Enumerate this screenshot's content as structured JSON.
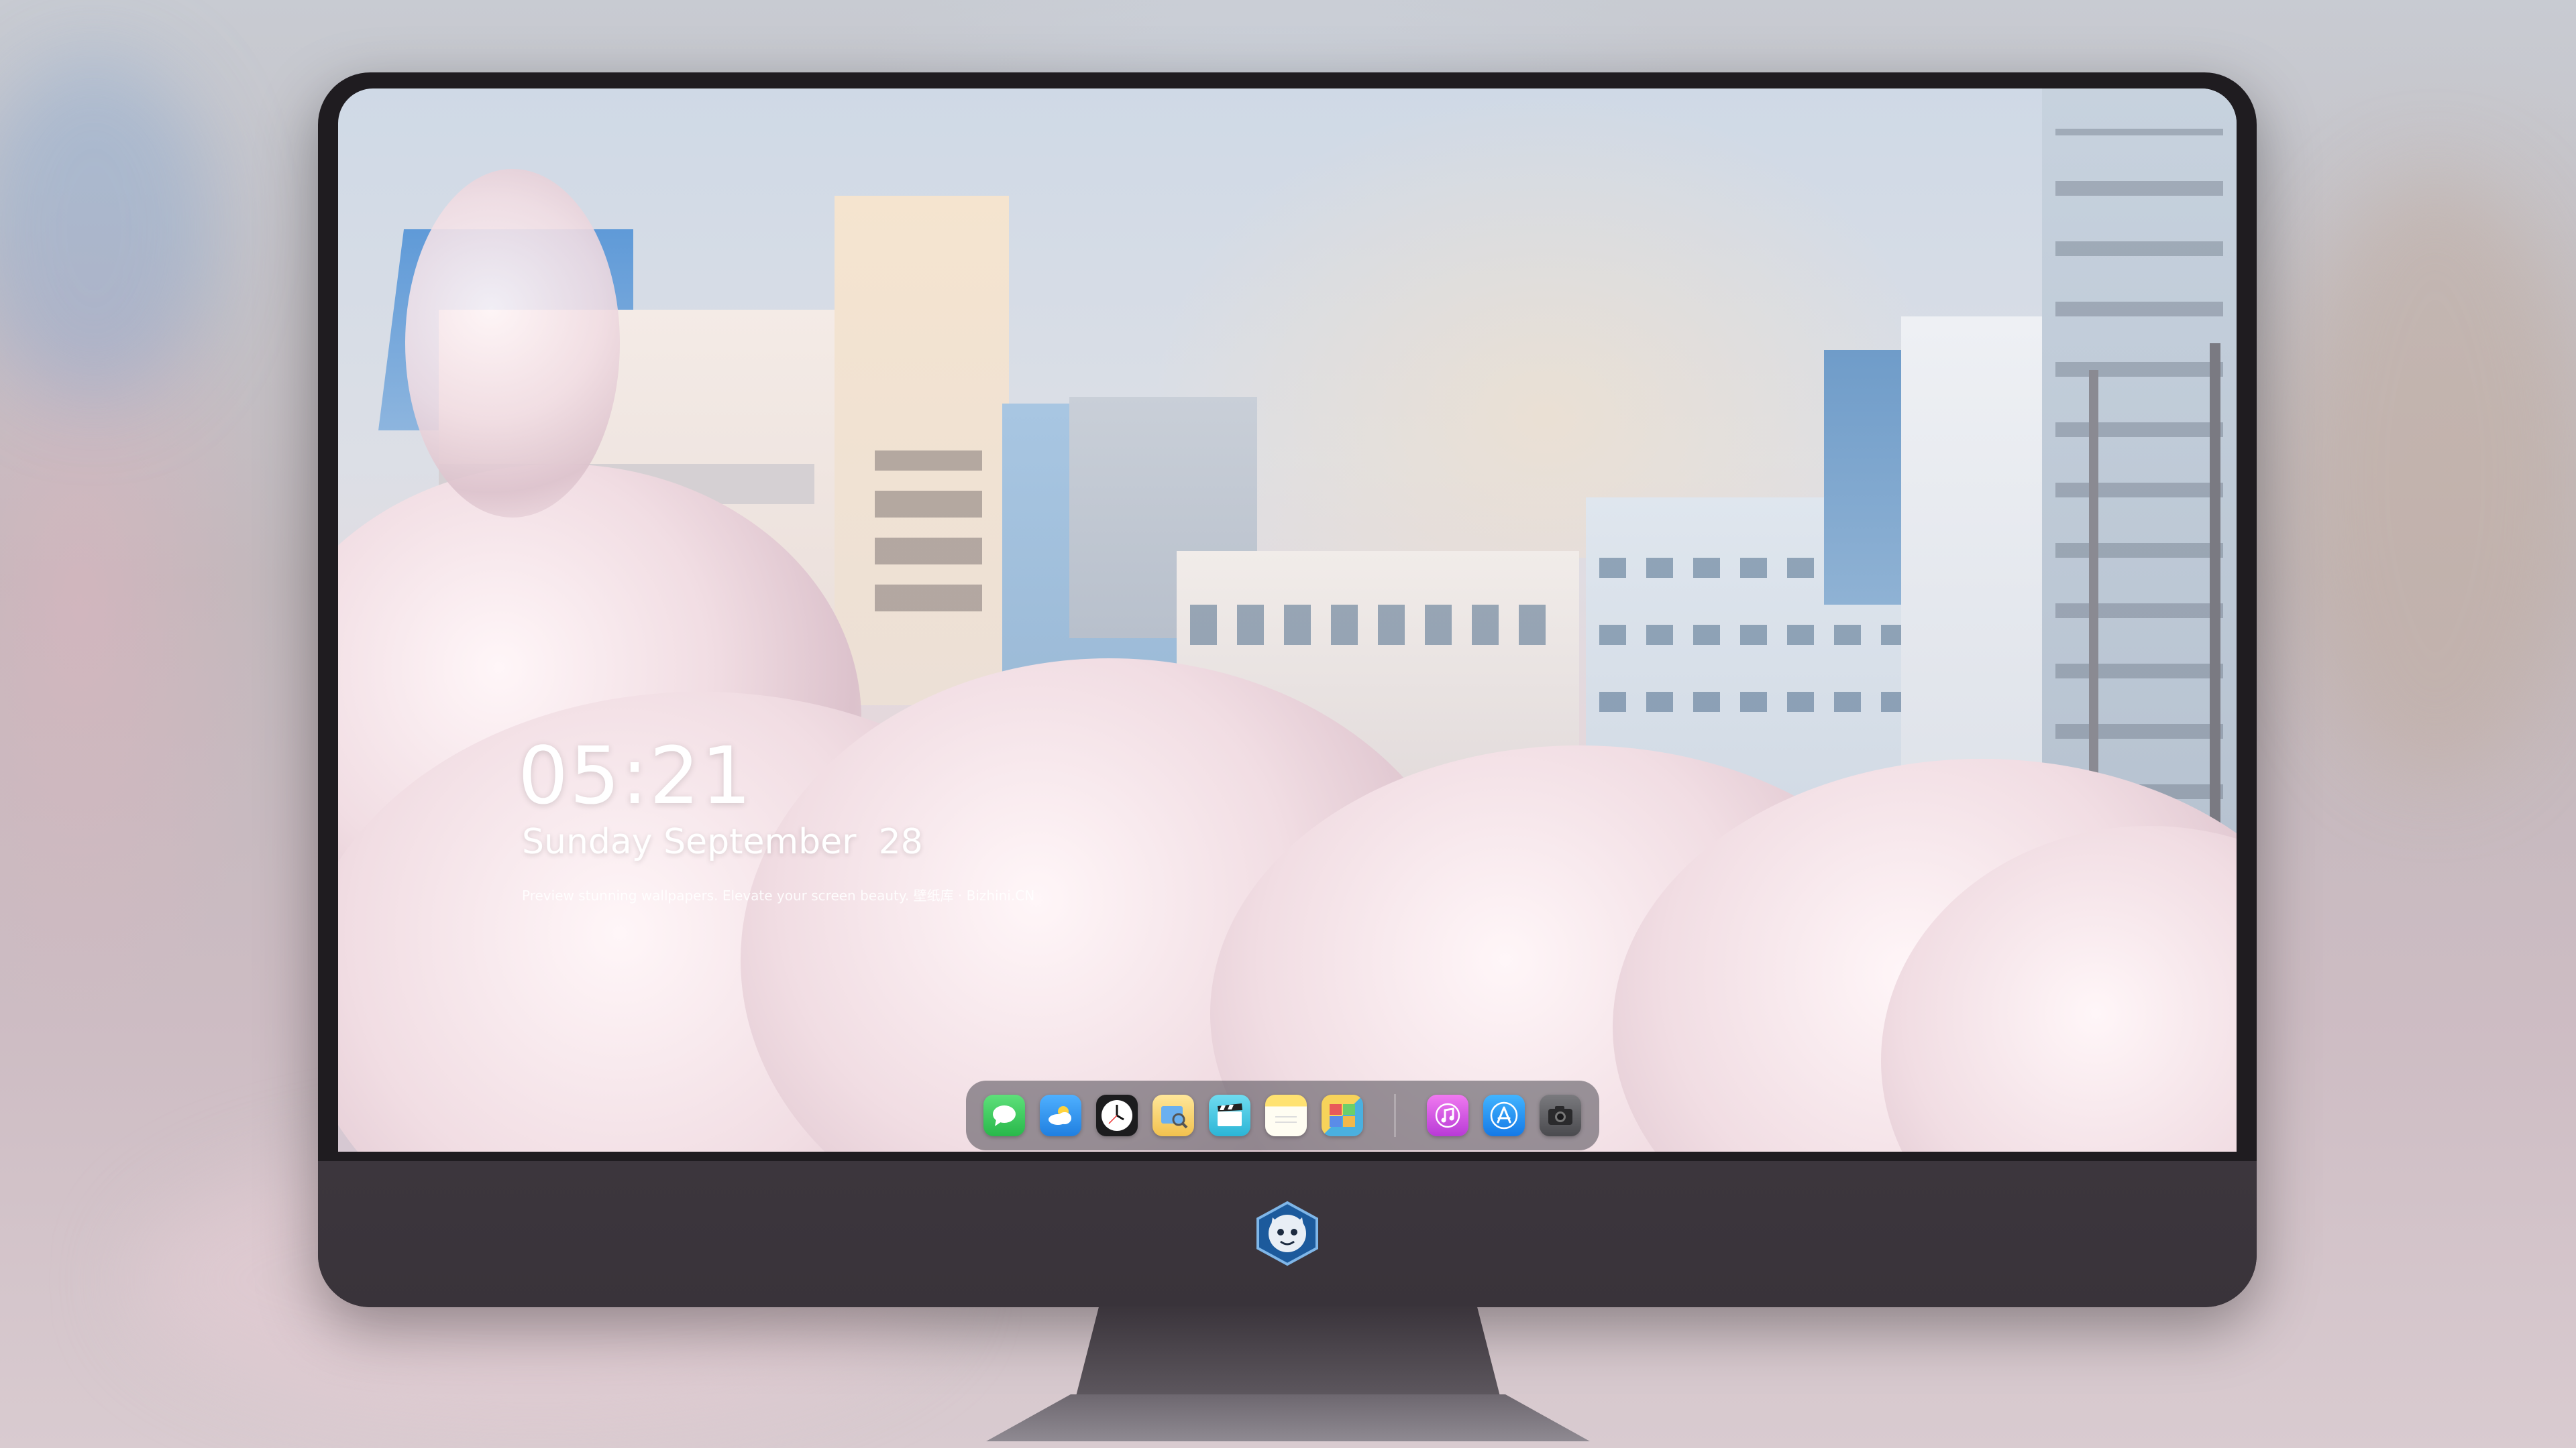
{
  "lockscreen": {
    "time": "05:21",
    "date": "Sunday September  28",
    "tagline": "Preview stunning wallpapers. Elevate your screen beauty. 壁纸库 · Bizhini.CN"
  },
  "dock": {
    "apps": [
      {
        "name": "Messages",
        "icon": "messages-icon",
        "color": "#34c759"
      },
      {
        "name": "Weather",
        "icon": "weather-icon",
        "color": "#2b8ff0"
      },
      {
        "name": "Clock",
        "icon": "clock-icon",
        "color": "#1c1c1e"
      },
      {
        "name": "Preview",
        "icon": "preview-icon",
        "color": "#f2c14e"
      },
      {
        "name": "Clips",
        "icon": "clips-icon",
        "color": "#3bc7e0"
      },
      {
        "name": "Notes",
        "icon": "notes-icon",
        "color": "#f7d65a"
      },
      {
        "name": "Photo Booth",
        "icon": "photobooth-icon",
        "color": "#e86a5b"
      },
      {
        "name": "iTunes",
        "icon": "music-icon",
        "color": "#d64bd9"
      },
      {
        "name": "App Store",
        "icon": "appstore-icon",
        "color": "#1e8cf0"
      },
      {
        "name": "Camera",
        "icon": "camera-icon",
        "color": "#5a5a5e"
      }
    ]
  },
  "monitor": {
    "logo": "mascot-logo"
  }
}
